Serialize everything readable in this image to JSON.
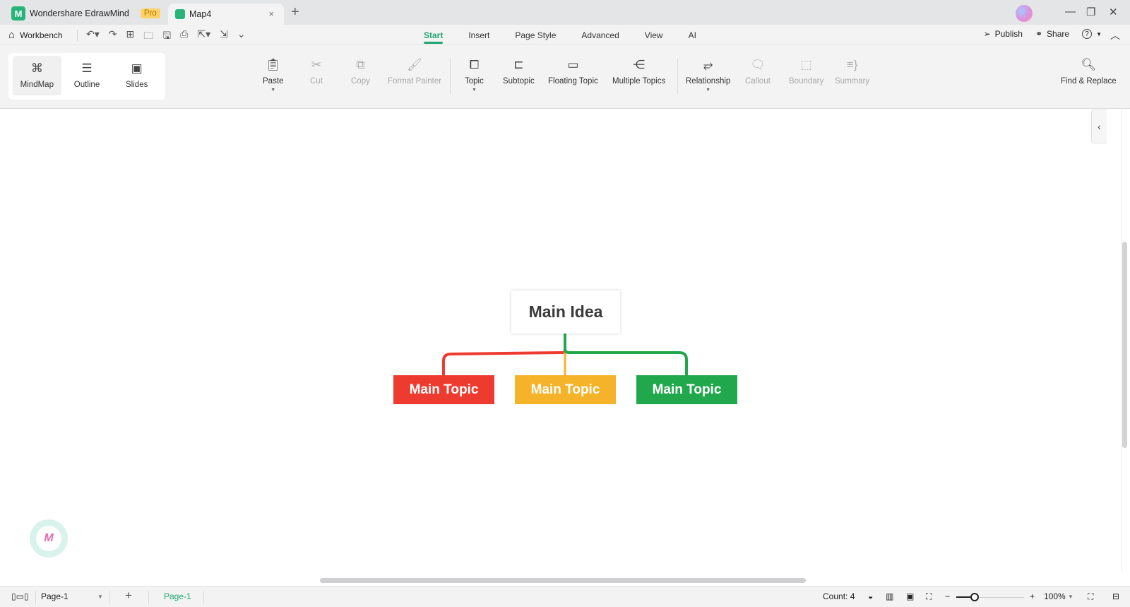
{
  "titlebar": {
    "app_name": "Wondershare EdrawMind",
    "badge": "Pro",
    "doc_tab": "Map4",
    "close_tab": "×",
    "new_tab": "+",
    "window_controls": {
      "minimize": "—",
      "restore": "❐",
      "close": "✕"
    }
  },
  "menubar": {
    "workbench": "Workbench",
    "quick_access": [
      "undo-icon",
      "redo-icon",
      "new-icon",
      "open-icon",
      "save-icon",
      "print-icon",
      "export-icon",
      "import-icon",
      "more-icon"
    ],
    "tabs": [
      {
        "label": "Start",
        "active": true
      },
      {
        "label": "Insert"
      },
      {
        "label": "Page Style"
      },
      {
        "label": "Advanced"
      },
      {
        "label": "View"
      },
      {
        "label": "AI"
      }
    ],
    "publish": "Publish",
    "share": "Share",
    "help": "?"
  },
  "view_switch": [
    {
      "label": "MindMap",
      "icon": "mindmap-icon",
      "active": true
    },
    {
      "label": "Outline",
      "icon": "outline-icon"
    },
    {
      "label": "Slides",
      "icon": "slides-icon"
    }
  ],
  "toolbar": {
    "paste": "Paste",
    "cut": "Cut",
    "copy": "Copy",
    "format_painter": "Format Painter",
    "topic": "Topic",
    "subtopic": "Subtopic",
    "floating_topic": "Floating Topic",
    "multiple_topics": "Multiple Topics",
    "relationship": "Relationship",
    "callout": "Callout",
    "boundary": "Boundary",
    "summary": "Summary",
    "find_replace": "Find & Replace"
  },
  "mindmap": {
    "main_idea": "Main Idea",
    "topics": [
      {
        "label": "Main Topic",
        "color": "#ee3b30"
      },
      {
        "label": "Main Topic",
        "color": "#f5b32a"
      },
      {
        "label": "Main Topic",
        "color": "#22a84c"
      }
    ]
  },
  "statusbar": {
    "page_select": "Page-1",
    "add_page": "+",
    "page_tab": "Page-1",
    "count": "Count: 4",
    "zoom_level": "100%",
    "zoom_minus": "−",
    "zoom_plus": "+"
  }
}
